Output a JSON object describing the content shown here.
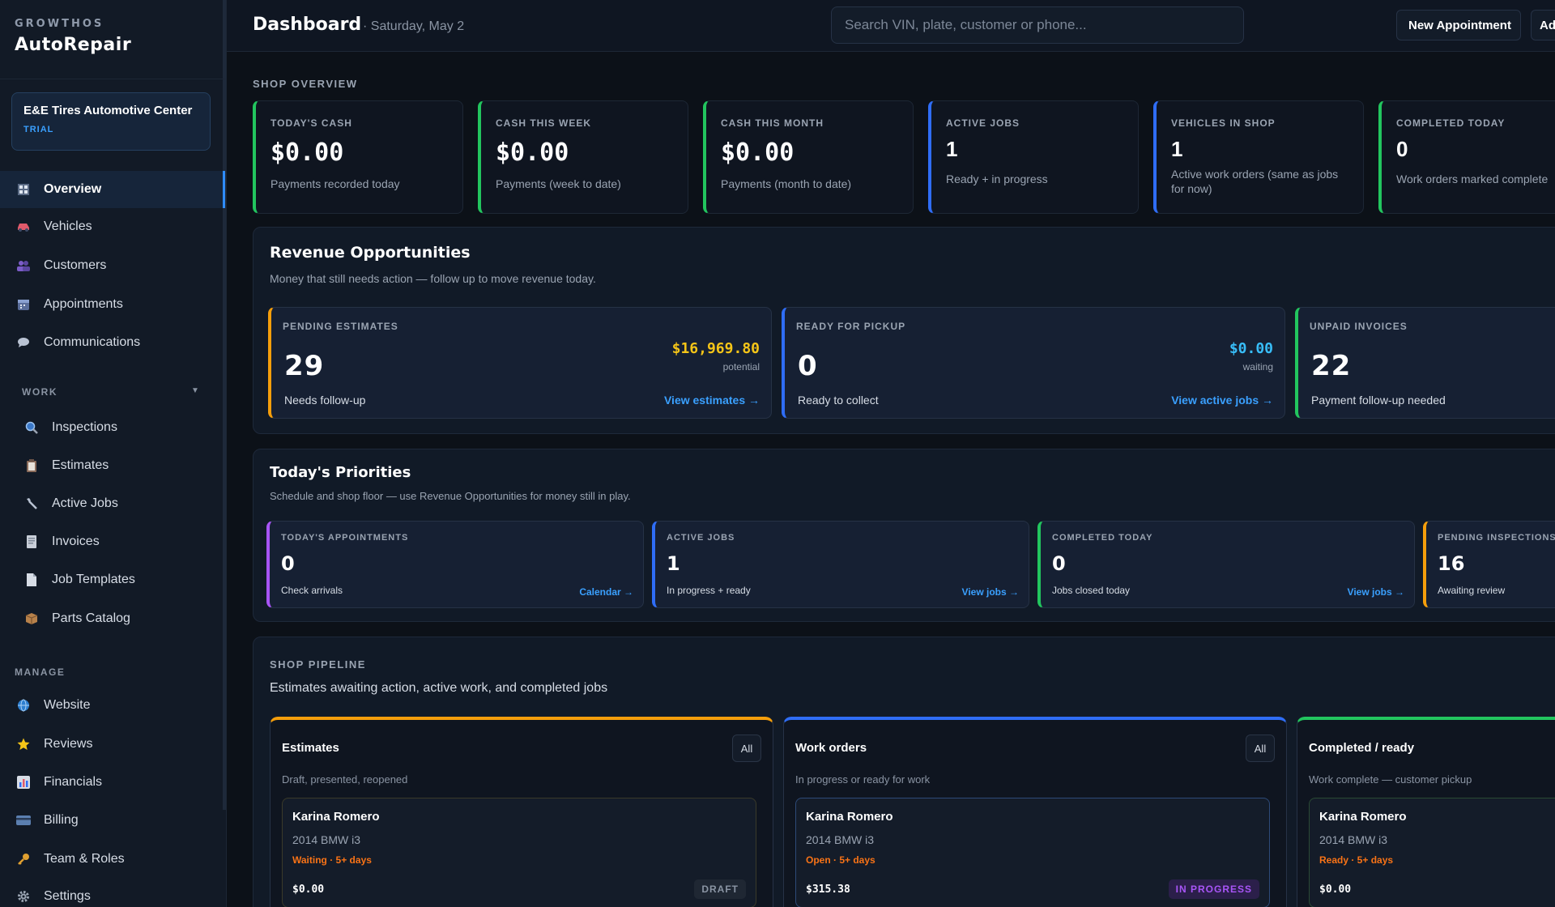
{
  "brand": {
    "small": "GROWTHOS",
    "name": "AutoRepair"
  },
  "shop": {
    "name": "E&E Tires Automotive Center",
    "tag": "TRIAL"
  },
  "nav": {
    "main": [
      {
        "label": "Overview",
        "icon": "grid-icon"
      },
      {
        "label": "Vehicles",
        "icon": "car-icon"
      },
      {
        "label": "Customers",
        "icon": "people-icon"
      },
      {
        "label": "Appointments",
        "icon": "calendar-icon"
      },
      {
        "label": "Communications",
        "icon": "chat-icon"
      }
    ],
    "work_label": "WORK",
    "work": [
      {
        "label": "Inspections",
        "icon": "magnifier-icon"
      },
      {
        "label": "Estimates",
        "icon": "clipboard-icon"
      },
      {
        "label": "Active Jobs",
        "icon": "wrench-icon"
      },
      {
        "label": "Invoices",
        "icon": "invoice-icon"
      },
      {
        "label": "Job Templates",
        "icon": "document-icon"
      },
      {
        "label": "Parts Catalog",
        "icon": "package-icon"
      }
    ],
    "manage_label": "MANAGE",
    "manage": [
      {
        "label": "Website",
        "icon": "globe-icon"
      },
      {
        "label": "Reviews",
        "icon": "star-icon"
      },
      {
        "label": "Financials",
        "icon": "bar-chart-icon"
      },
      {
        "label": "Billing",
        "icon": "credit-card-icon"
      },
      {
        "label": "Team & Roles",
        "icon": "key-icon"
      },
      {
        "label": "Settings",
        "icon": "gear-icon"
      }
    ]
  },
  "header": {
    "title": "Dashboard",
    "date": "· Saturday, May 2",
    "search_placeholder": "Search VIN, plate, customer or phone...",
    "new_appointment": "New Appointment",
    "add_label": "Ad"
  },
  "overview": {
    "title": "SHOP OVERVIEW",
    "cards": [
      {
        "label": "TODAY'S CASH",
        "value": "$0.00",
        "sub": "Payments recorded today",
        "color": "#22c55e"
      },
      {
        "label": "CASH THIS WEEK",
        "value": "$0.00",
        "sub": "Payments (week to date)",
        "color": "#22c55e"
      },
      {
        "label": "CASH THIS MONTH",
        "value": "$0.00",
        "sub": "Payments (month to date)",
        "color": "#22c55e"
      },
      {
        "label": "ACTIVE JOBS",
        "value": "1",
        "sub": "Ready + in progress",
        "color": "#2f6df6"
      },
      {
        "label": "VEHICLES IN SHOP",
        "value": "1",
        "sub": "Active work orders (same as jobs for now)",
        "color": "#2f6df6"
      },
      {
        "label": "COMPLETED TODAY",
        "value": "0",
        "sub": "Work orders marked complete",
        "color": "#22c55e"
      }
    ]
  },
  "revenue": {
    "title": "Revenue Opportunities",
    "subtitle": "Money that still needs action — follow up to move revenue today.",
    "cards": [
      {
        "label": "PENDING ESTIMATES",
        "value": "29",
        "money": "$16,969.80",
        "money_sub": "potential",
        "money_color": "#f5c518",
        "sub": "Needs follow-up",
        "link": "View estimates →"
      },
      {
        "label": "READY FOR PICKUP",
        "value": "0",
        "money": "$0.00",
        "money_sub": "waiting",
        "money_color": "#38bdf8",
        "sub": "Ready to collect",
        "link": "View active jobs →"
      },
      {
        "label": "UNPAID INVOICES",
        "value": "22",
        "sub": "Payment follow-up needed"
      }
    ]
  },
  "priorities": {
    "title": "Today's Priorities",
    "subtitle": "Schedule and shop floor — use Revenue Opportunities for money still in play.",
    "cards": [
      {
        "label": "TODAY'S APPOINTMENTS",
        "value": "0",
        "sub": "Check arrivals",
        "link": "Calendar →"
      },
      {
        "label": "ACTIVE JOBS",
        "value": "1",
        "sub": "In progress + ready",
        "link": "View jobs →"
      },
      {
        "label": "COMPLETED TODAY",
        "value": "0",
        "sub": "Jobs closed today",
        "link": "View jobs →"
      },
      {
        "label": "PENDING INSPECTIONS",
        "value": "16",
        "sub": "Awaiting review"
      }
    ]
  },
  "pipeline": {
    "title": "SHOP PIPELINE",
    "subtitle": "Estimates awaiting action, active work, and completed jobs",
    "columns": [
      {
        "title": "Estimates",
        "all": "All",
        "sub": "Draft, presented, reopened",
        "job": {
          "name": "Karina Romero",
          "vehicle": "2014 BMW i3",
          "status": "Waiting · 5+ days",
          "amount": "$0.00",
          "badge": "DRAFT"
        }
      },
      {
        "title": "Work orders",
        "all": "All",
        "sub": "In progress or ready for work",
        "job": {
          "name": "Karina Romero",
          "vehicle": "2014 BMW i3",
          "status": "Open · 5+ days",
          "amount": "$315.38",
          "badge": "IN PROGRESS"
        }
      },
      {
        "title": "Completed / ready",
        "sub": "Work complete — customer pickup",
        "job": {
          "name": "Karina Romero",
          "vehicle": "2014 BMW i3",
          "status": "Ready · 5+ days",
          "amount": "$0.00"
        }
      }
    ]
  }
}
